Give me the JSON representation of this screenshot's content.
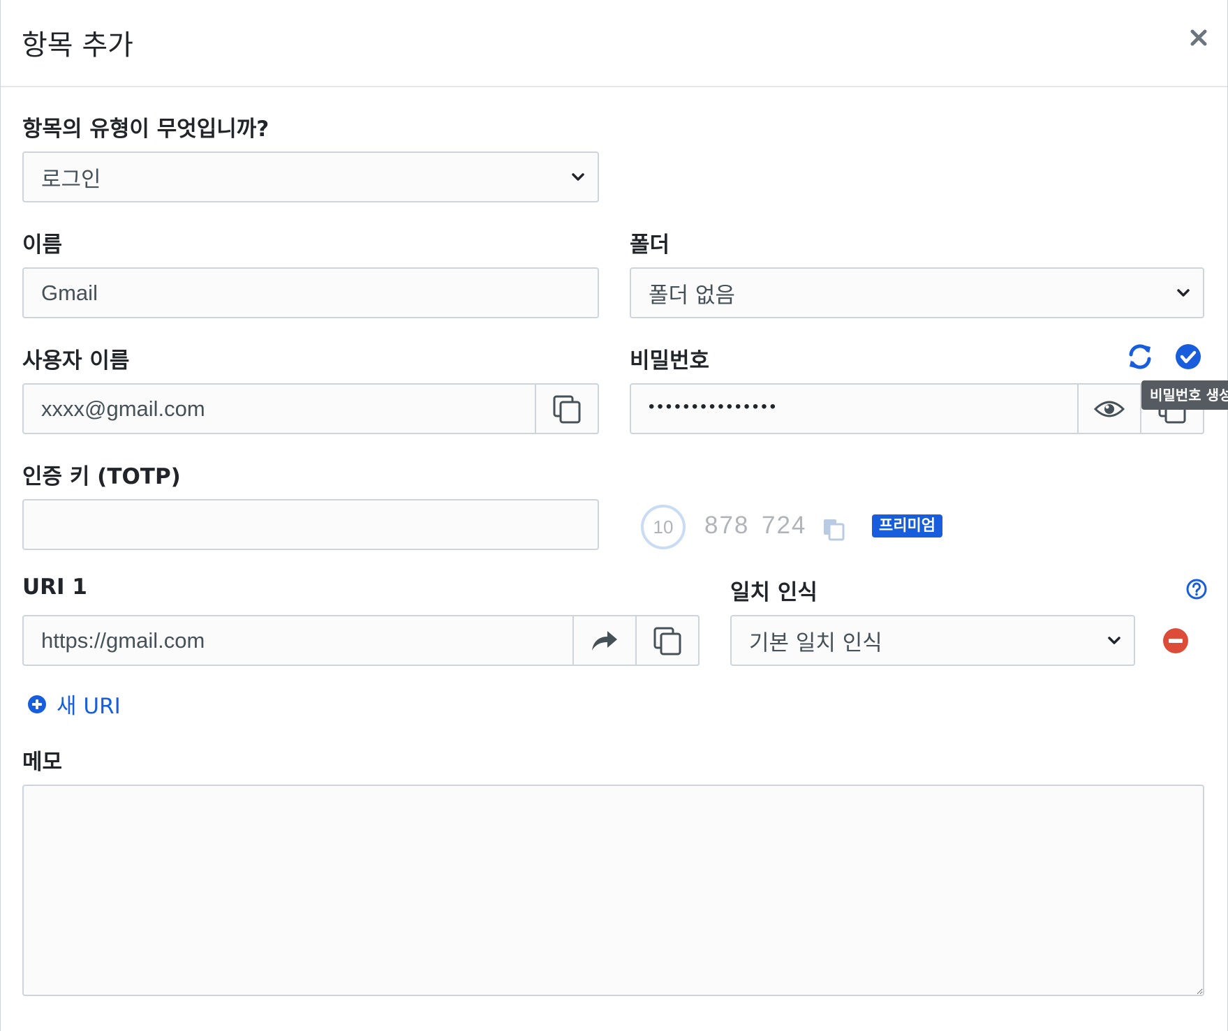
{
  "dialog": {
    "title": "항목 추가",
    "close_label": "×"
  },
  "type_field": {
    "label": "항목의 유형이 무엇입니까?",
    "value": "로그인"
  },
  "name_field": {
    "label": "이름",
    "value": "Gmail"
  },
  "folder_field": {
    "label": "폴더",
    "value": "폴더 없음"
  },
  "username_field": {
    "label": "사용자 이름",
    "value": "xxxx@gmail.com"
  },
  "password_field": {
    "label": "비밀번호",
    "value": "•••••••••••••••",
    "tooltip": "비밀번호 생성"
  },
  "totp_field": {
    "label": "인증 키 (TOTP)",
    "value": "",
    "countdown": "10",
    "code_part1": "878",
    "code_part2": "724",
    "premium_badge": "프리미엄"
  },
  "uri_field": {
    "label": "URI 1",
    "value": "https://gmail.com"
  },
  "match_field": {
    "label": "일치 인식",
    "value": "기본 일치 인식"
  },
  "new_uri": {
    "label": "새 URI"
  },
  "notes_field": {
    "label": "메모"
  },
  "colors": {
    "primary": "#175ddc",
    "danger": "#dd4b39",
    "muted": "#6c757d",
    "border": "#ced4da"
  },
  "icons": [
    "close-icon",
    "chevron-down-icon",
    "copy-icon",
    "eye-icon",
    "refresh-icon",
    "check-circle-icon",
    "share-icon",
    "question-circle-icon",
    "minus-circle-icon",
    "plus-circle-icon"
  ]
}
